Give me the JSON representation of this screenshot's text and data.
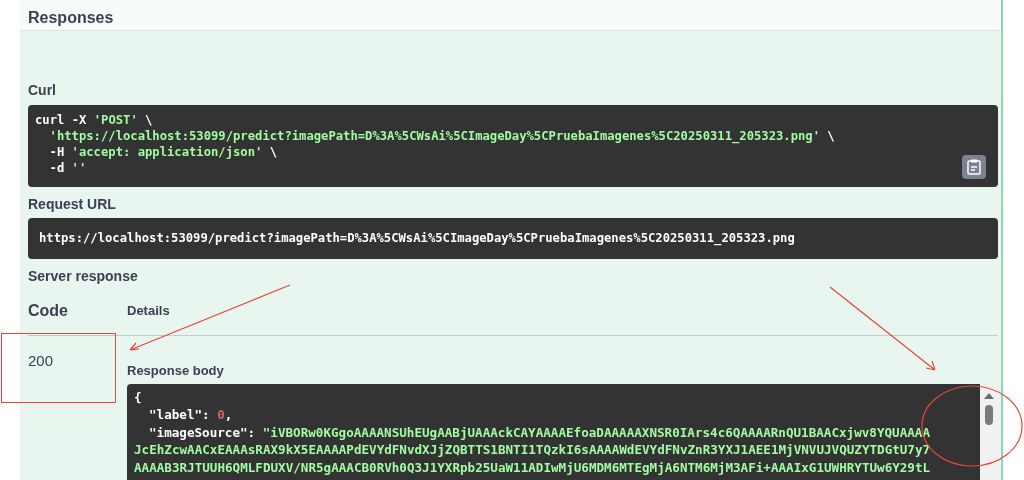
{
  "section_title": "Responses",
  "curl": {
    "label": "Curl",
    "lines": [
      {
        "kind": "plain",
        "parts": [
          {
            "kind": "plain",
            "text": "curl -X "
          },
          {
            "kind": "string",
            "text": "'POST'"
          },
          {
            "kind": "plain",
            "text": " \\"
          }
        ]
      },
      {
        "kind": "indent",
        "parts": [
          {
            "kind": "string",
            "text": "'https://localhost:53099/predict?imagePath=D%3A%5CWsAi%5CImageDay%5CPruebaImagenes%5C20250311_205323.png'"
          },
          {
            "kind": "plain",
            "text": " \\"
          }
        ]
      },
      {
        "kind": "indent",
        "parts": [
          {
            "kind": "plain",
            "text": "-H "
          },
          {
            "kind": "string",
            "text": "'accept: application/json'"
          },
          {
            "kind": "plain",
            "text": " \\"
          }
        ]
      },
      {
        "kind": "indent",
        "parts": [
          {
            "kind": "plain",
            "text": "-d "
          },
          {
            "kind": "string",
            "text": "''"
          }
        ]
      }
    ]
  },
  "request_url": {
    "label": "Request URL",
    "value": "https://localhost:53099/predict?imagePath=D%3A%5CWsAi%5CImageDay%5CPruebaImagenes%5C20250311_205323.png"
  },
  "server_response": {
    "label": "Server response",
    "columns": [
      "Code",
      "Details"
    ],
    "code": "200",
    "body_label": "Response body",
    "body": {
      "lines": [
        {
          "kind": "plain",
          "parts": [
            {
              "kind": "punct",
              "text": "{"
            }
          ]
        },
        {
          "kind": "indent",
          "parts": [
            {
              "kind": "key",
              "text": "\"label\""
            },
            {
              "kind": "punct",
              "text": ": "
            },
            {
              "kind": "number",
              "text": "0"
            },
            {
              "kind": "punct",
              "text": ","
            }
          ]
        },
        {
          "kind": "indent",
          "parts": [
            {
              "kind": "key",
              "text": "\"imageSource\""
            },
            {
              "kind": "punct",
              "text": ": "
            },
            {
              "kind": "string",
              "text": "\"iVBORw0KGgoAAAANSUhEUgAABjUAAAckCAYAAAAEfoaDAAAAAXNSR0IArs4c6QAAAARnQU1BAACxjwv8YQUAAAA"
            }
          ]
        },
        {
          "kind": "plain",
          "parts": [
            {
              "kind": "string",
              "text": "JcEhZcwAACxEAAAsRAX9kX5EAAAAPdEVYdFNvdXJjZQBTTS1BNTI1TQzkI6sAAAAWdEVYdFNvZnR3YXJ1AEE1MjVNVUJVQUZYTDGtU7y7"
            }
          ]
        },
        {
          "kind": "plain",
          "parts": [
            {
              "kind": "string",
              "text": "AAAAB3RJTUUH6QMLFDUXV/NR5gAAACB0RVh0Q3J1YXRpb25UaW11ADIwMjU6MDM6MTEgMjA6NTM6MjM3AFi+AAAIxG1UWHRYTUw6Y29tL"
            }
          ]
        }
      ]
    }
  }
}
